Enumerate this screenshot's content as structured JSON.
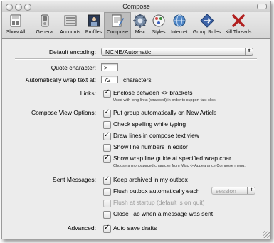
{
  "window": {
    "title": "Compose"
  },
  "toolbar": {
    "items": [
      {
        "label": "Show All",
        "icon": "show-all-icon",
        "selected": false
      },
      {
        "label": "General",
        "icon": "general-switch-icon",
        "selected": false
      },
      {
        "label": "Accounts",
        "icon": "accounts-icon",
        "selected": false
      },
      {
        "label": "Profiles",
        "icon": "profiles-icon",
        "selected": false
      },
      {
        "label": "Compose",
        "icon": "compose-icon",
        "selected": true
      },
      {
        "label": "Misc",
        "icon": "gear-icon",
        "selected": false
      },
      {
        "label": "Styles",
        "icon": "styles-icon",
        "selected": false
      },
      {
        "label": "Internet",
        "icon": "globe-icon",
        "selected": false
      },
      {
        "label": "Group Rules",
        "icon": "group-rules-icon",
        "selected": false
      },
      {
        "label": "Kill Threads",
        "icon": "kill-threads-icon",
        "selected": false
      }
    ]
  },
  "settings": {
    "default_encoding": {
      "label": "Default encoding:",
      "value": "NCNE/Automatic"
    },
    "quote_character": {
      "label": "Quote character:",
      "value": ">"
    },
    "wrap": {
      "label": "Automatically wrap text at:",
      "value": "72",
      "suffix": "characters"
    },
    "links": {
      "label": "Links:",
      "option": {
        "label": "Enclose between <> brackets",
        "checked": true
      },
      "note": "Used with long links (wrapped) in order to support fast click"
    },
    "compose_view": {
      "label": "Compose View Options:",
      "options": [
        {
          "label": "Put group automatically on New Article",
          "checked": true
        },
        {
          "label": "Check spelling while typing",
          "checked": false
        },
        {
          "label": "Draw lines in compose text view",
          "checked": true
        },
        {
          "label": "Show line numbers in editor",
          "checked": false
        },
        {
          "label": "Show wrap line guide at specified wrap char",
          "checked": true
        }
      ],
      "note": "Choose a monospaced character from Misc -> Appearance Compose menu."
    },
    "sent_messages": {
      "label": "Sent Messages:",
      "keep_archived": {
        "label": "Keep archived in my outbox",
        "checked": true
      },
      "flush": {
        "label": "Flush outbox automatically each",
        "checked": false,
        "period": "session"
      },
      "flush_startup": {
        "label": "Flush at startup (default is on quit)",
        "checked": false,
        "disabled": true
      },
      "close_tab": {
        "label": "Close Tab when a message was sent",
        "checked": false
      }
    },
    "advanced": {
      "label": "Advanced:",
      "option": {
        "label": "Auto save drafts",
        "checked": true
      }
    }
  },
  "colors": {
    "window_bg": "#ececec",
    "toolbar_selected": "#bdbdbd",
    "disabled_text": "#9a9a9a"
  }
}
